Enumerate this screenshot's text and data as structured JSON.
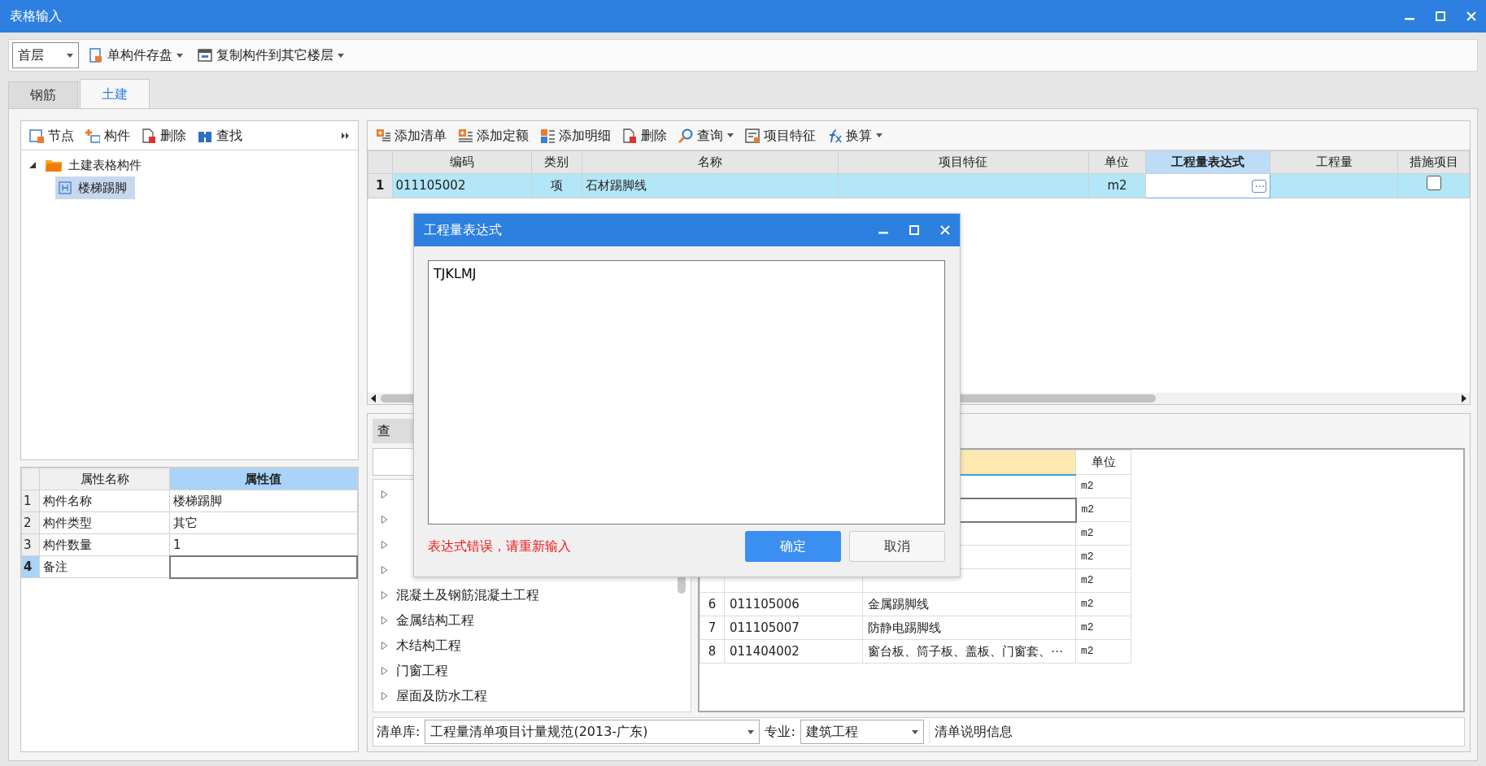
{
  "window": {
    "title": "表格输入"
  },
  "toolbar": {
    "floor": "首层",
    "buttons": [
      {
        "label": "单构件存盘",
        "kind": "save",
        "dropdown": true
      },
      {
        "label": "复制构件到其它楼层",
        "kind": "copy",
        "dropdown": true
      }
    ]
  },
  "tabs": [
    {
      "label": "钢筋",
      "selected": false
    },
    {
      "label": "土建",
      "selected": true
    }
  ],
  "component_panel": {
    "toolbar": [
      {
        "label": "节点",
        "kind": "node"
      },
      {
        "label": "构件",
        "kind": "component"
      },
      {
        "label": "删除",
        "kind": "delete"
      },
      {
        "label": "查找",
        "kind": "find"
      }
    ],
    "tree": [
      {
        "label": "土建表格构件",
        "kind": "folder",
        "expanded": true,
        "selected": false,
        "children": [
          {
            "label": "楼梯踢脚",
            "kind": "item",
            "selected": true
          }
        ]
      }
    ]
  },
  "properties": {
    "columns": [
      "属性名称",
      "属性值"
    ],
    "rows": [
      {
        "index": "1",
        "name": "构件名称",
        "value": "楼梯踢脚",
        "selected": false
      },
      {
        "index": "2",
        "name": "构件类型",
        "value": "其它",
        "selected": false
      },
      {
        "index": "3",
        "name": "构件数量",
        "value": "1",
        "selected": false
      },
      {
        "index": "4",
        "name": "备注",
        "selected": true
      }
    ]
  },
  "list_toolbar": [
    {
      "label": "添加清单",
      "kind": "add-list",
      "dropdown": false
    },
    {
      "label": "添加定额",
      "kind": "add-quota",
      "dropdown": false
    },
    {
      "label": "添加明细",
      "kind": "add-detail",
      "dropdown": false
    },
    {
      "label": "删除",
      "kind": "delete",
      "dropdown": false
    },
    {
      "label": "查询",
      "kind": "query",
      "dropdown": true
    },
    {
      "label": "项目特征",
      "kind": "feature",
      "dropdown": false
    },
    {
      "label": "换算",
      "kind": "convert",
      "dropdown": true
    }
  ],
  "grid": {
    "columns": [
      {
        "label": "编码",
        "selected": false
      },
      {
        "label": "类别",
        "selected": false
      },
      {
        "label": "名称",
        "selected": false
      },
      {
        "label": "项目特征",
        "selected": false
      },
      {
        "label": "单位",
        "selected": false
      },
      {
        "label": "工程量表达式",
        "selected": true
      },
      {
        "label": "工程量",
        "selected": false
      },
      {
        "label": "措施项目",
        "selected": false
      }
    ],
    "rows": [
      {
        "index": "1",
        "code": "011105002",
        "category": "项",
        "name": "石材踢脚线",
        "unit": "m2",
        "edit_button": "⋯",
        "measure": false,
        "selected": true
      }
    ]
  },
  "query_panel": {
    "tab": "查",
    "tree": [
      {
        "expanded": false
      },
      {
        "expanded": false
      },
      {
        "expanded": false
      },
      {
        "expanded": false
      },
      {
        "label": "混凝土及钢筋混凝土工程",
        "expanded": false
      },
      {
        "label": "金属结构工程",
        "expanded": false
      },
      {
        "label": "木结构工程",
        "expanded": false
      },
      {
        "label": "门窗工程",
        "expanded": false
      },
      {
        "label": "屋面及防水工程",
        "expanded": false
      }
    ],
    "table": {
      "columns": [
        {
          "selected": true
        },
        {
          "label": "单位",
          "selected": false
        }
      ],
      "rows": [
        {
          "unit": "m2",
          "selected": false
        },
        {
          "unit": "m2",
          "selected": true
        },
        {
          "unit": "m2",
          "selected": false
        },
        {
          "unit": "m2",
          "selected": false
        },
        {
          "unit": "m2",
          "selected": false
        },
        {
          "index": "6",
          "code": "011105006",
          "name": "金属踢脚线",
          "unit": "m2",
          "selected": false
        },
        {
          "index": "7",
          "code": "011105007",
          "name": "防静电踢脚线",
          "unit": "m2",
          "selected": false
        },
        {
          "index": "8",
          "code": "011404002",
          "name": "窗台板、筒子板、盖板、门窗套、⋯",
          "unit": "m2",
          "selected": false
        }
      ]
    },
    "library_label": "清单库:",
    "library": "工程量清单项目计量规范(2013-广东)",
    "specialty_label": "专业:",
    "specialty": "建筑工程",
    "info_button": "清单说明信息"
  },
  "dialog": {
    "title": "工程量表达式",
    "expression": "TJKLMJ",
    "error": "表达式错误，请重新输入",
    "buttons": [
      {
        "label": "确定",
        "kind": "primary"
      },
      {
        "label": "取消",
        "kind": "secondary"
      }
    ]
  }
}
